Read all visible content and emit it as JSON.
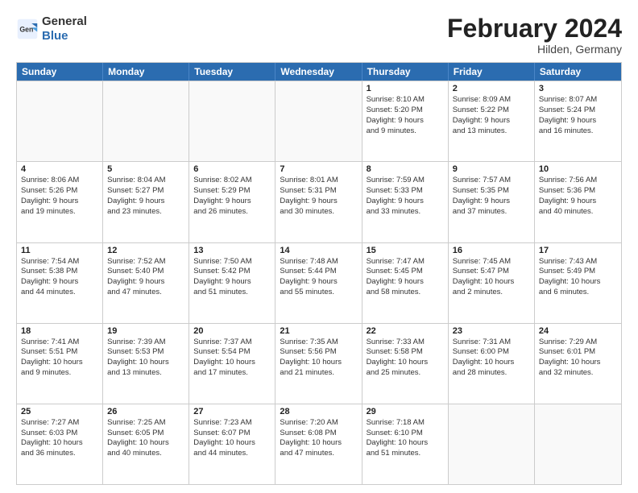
{
  "logo": {
    "general": "General",
    "blue": "Blue"
  },
  "title": "February 2024",
  "location": "Hilden, Germany",
  "days_of_week": [
    "Sunday",
    "Monday",
    "Tuesday",
    "Wednesday",
    "Thursday",
    "Friday",
    "Saturday"
  ],
  "weeks": [
    [
      {
        "day": "",
        "info": ""
      },
      {
        "day": "",
        "info": ""
      },
      {
        "day": "",
        "info": ""
      },
      {
        "day": "",
        "info": ""
      },
      {
        "day": "1",
        "info": "Sunrise: 8:10 AM\nSunset: 5:20 PM\nDaylight: 9 hours\nand 9 minutes."
      },
      {
        "day": "2",
        "info": "Sunrise: 8:09 AM\nSunset: 5:22 PM\nDaylight: 9 hours\nand 13 minutes."
      },
      {
        "day": "3",
        "info": "Sunrise: 8:07 AM\nSunset: 5:24 PM\nDaylight: 9 hours\nand 16 minutes."
      }
    ],
    [
      {
        "day": "4",
        "info": "Sunrise: 8:06 AM\nSunset: 5:26 PM\nDaylight: 9 hours\nand 19 minutes."
      },
      {
        "day": "5",
        "info": "Sunrise: 8:04 AM\nSunset: 5:27 PM\nDaylight: 9 hours\nand 23 minutes."
      },
      {
        "day": "6",
        "info": "Sunrise: 8:02 AM\nSunset: 5:29 PM\nDaylight: 9 hours\nand 26 minutes."
      },
      {
        "day": "7",
        "info": "Sunrise: 8:01 AM\nSunset: 5:31 PM\nDaylight: 9 hours\nand 30 minutes."
      },
      {
        "day": "8",
        "info": "Sunrise: 7:59 AM\nSunset: 5:33 PM\nDaylight: 9 hours\nand 33 minutes."
      },
      {
        "day": "9",
        "info": "Sunrise: 7:57 AM\nSunset: 5:35 PM\nDaylight: 9 hours\nand 37 minutes."
      },
      {
        "day": "10",
        "info": "Sunrise: 7:56 AM\nSunset: 5:36 PM\nDaylight: 9 hours\nand 40 minutes."
      }
    ],
    [
      {
        "day": "11",
        "info": "Sunrise: 7:54 AM\nSunset: 5:38 PM\nDaylight: 9 hours\nand 44 minutes."
      },
      {
        "day": "12",
        "info": "Sunrise: 7:52 AM\nSunset: 5:40 PM\nDaylight: 9 hours\nand 47 minutes."
      },
      {
        "day": "13",
        "info": "Sunrise: 7:50 AM\nSunset: 5:42 PM\nDaylight: 9 hours\nand 51 minutes."
      },
      {
        "day": "14",
        "info": "Sunrise: 7:48 AM\nSunset: 5:44 PM\nDaylight: 9 hours\nand 55 minutes."
      },
      {
        "day": "15",
        "info": "Sunrise: 7:47 AM\nSunset: 5:45 PM\nDaylight: 9 hours\nand 58 minutes."
      },
      {
        "day": "16",
        "info": "Sunrise: 7:45 AM\nSunset: 5:47 PM\nDaylight: 10 hours\nand 2 minutes."
      },
      {
        "day": "17",
        "info": "Sunrise: 7:43 AM\nSunset: 5:49 PM\nDaylight: 10 hours\nand 6 minutes."
      }
    ],
    [
      {
        "day": "18",
        "info": "Sunrise: 7:41 AM\nSunset: 5:51 PM\nDaylight: 10 hours\nand 9 minutes."
      },
      {
        "day": "19",
        "info": "Sunrise: 7:39 AM\nSunset: 5:53 PM\nDaylight: 10 hours\nand 13 minutes."
      },
      {
        "day": "20",
        "info": "Sunrise: 7:37 AM\nSunset: 5:54 PM\nDaylight: 10 hours\nand 17 minutes."
      },
      {
        "day": "21",
        "info": "Sunrise: 7:35 AM\nSunset: 5:56 PM\nDaylight: 10 hours\nand 21 minutes."
      },
      {
        "day": "22",
        "info": "Sunrise: 7:33 AM\nSunset: 5:58 PM\nDaylight: 10 hours\nand 25 minutes."
      },
      {
        "day": "23",
        "info": "Sunrise: 7:31 AM\nSunset: 6:00 PM\nDaylight: 10 hours\nand 28 minutes."
      },
      {
        "day": "24",
        "info": "Sunrise: 7:29 AM\nSunset: 6:01 PM\nDaylight: 10 hours\nand 32 minutes."
      }
    ],
    [
      {
        "day": "25",
        "info": "Sunrise: 7:27 AM\nSunset: 6:03 PM\nDaylight: 10 hours\nand 36 minutes."
      },
      {
        "day": "26",
        "info": "Sunrise: 7:25 AM\nSunset: 6:05 PM\nDaylight: 10 hours\nand 40 minutes."
      },
      {
        "day": "27",
        "info": "Sunrise: 7:23 AM\nSunset: 6:07 PM\nDaylight: 10 hours\nand 44 minutes."
      },
      {
        "day": "28",
        "info": "Sunrise: 7:20 AM\nSunset: 6:08 PM\nDaylight: 10 hours\nand 47 minutes."
      },
      {
        "day": "29",
        "info": "Sunrise: 7:18 AM\nSunset: 6:10 PM\nDaylight: 10 hours\nand 51 minutes."
      },
      {
        "day": "",
        "info": ""
      },
      {
        "day": "",
        "info": ""
      }
    ]
  ]
}
